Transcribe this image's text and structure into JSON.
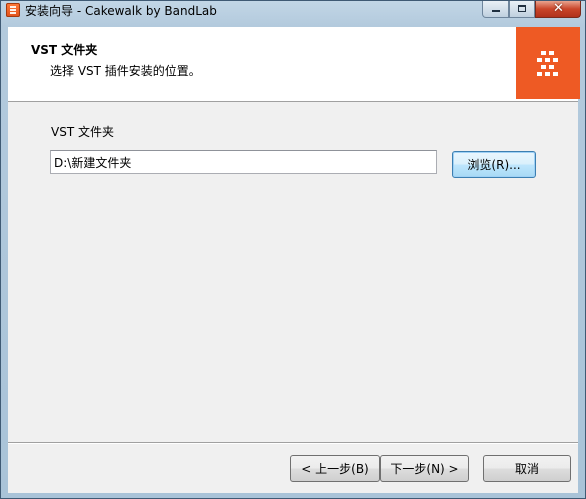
{
  "window": {
    "title": "安装向导 - Cakewalk by BandLab",
    "controls": {
      "minimize": "–",
      "maximize": "□",
      "close": "✕"
    }
  },
  "header": {
    "title": "VST 文件夹",
    "subtitle": "选择 VST 插件安装的位置。",
    "logo_color": "#ee5a24"
  },
  "main": {
    "folder_label": "VST 文件夹",
    "path_value": "D:\\新建文件夹",
    "browse_label": "浏览(R)..."
  },
  "footer": {
    "back_label": "< 上一步(B)",
    "next_label": "下一步(N) >",
    "cancel_label": "取消"
  },
  "icons": {
    "app": "cakewalk-app-icon",
    "logo": "cakewalk-logo"
  }
}
